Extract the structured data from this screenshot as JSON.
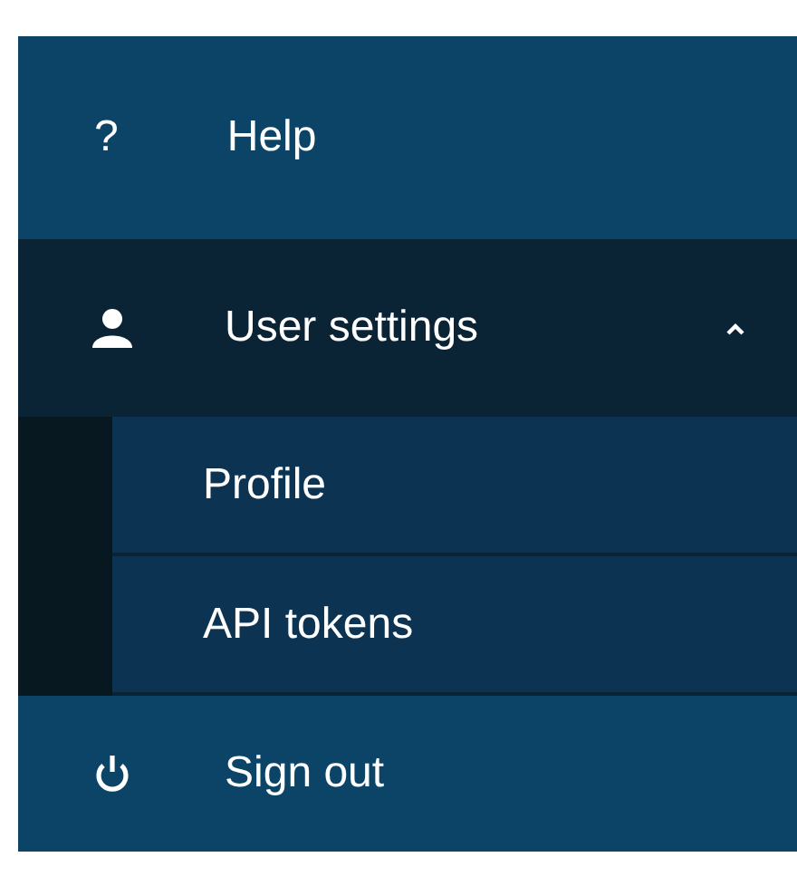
{
  "menu": [
    {
      "kind": "text-icon",
      "icon": "?",
      "label": "Help"
    },
    {
      "kind": "group",
      "label": "User settings",
      "expanded": true,
      "children": [
        {
          "label": "Profile",
          "selected": false
        },
        {
          "label": "API tokens",
          "selected": false
        }
      ]
    },
    {
      "kind": "power",
      "label": "Sign out"
    }
  ]
}
